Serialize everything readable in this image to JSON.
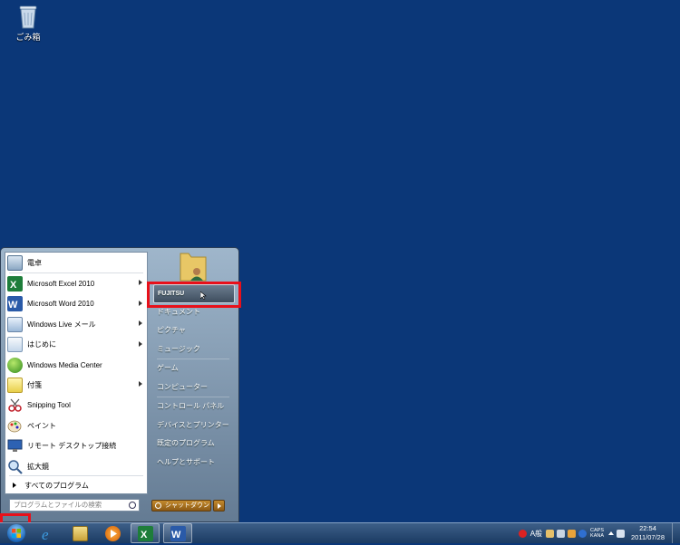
{
  "desktop": {
    "recycle_bin_label": "ごみ箱",
    "background_color": "#0b3778"
  },
  "start_menu": {
    "programs": [
      {
        "label": "電卓",
        "icon": "calculator-icon",
        "submenu": false
      },
      {
        "label": "Microsoft Excel 2010",
        "icon": "excel-icon",
        "submenu": true
      },
      {
        "label": "Microsoft Word 2010",
        "icon": "word-icon",
        "submenu": true
      },
      {
        "label": "Windows Live メール",
        "icon": "mail-icon",
        "submenu": true
      },
      {
        "label": "はじめに",
        "icon": "getting-started-icon",
        "submenu": true
      },
      {
        "label": "Windows Media Center",
        "icon": "media-center-icon",
        "submenu": false
      },
      {
        "label": "付箋",
        "icon": "sticky-notes-icon",
        "submenu": true
      },
      {
        "label": "Snipping Tool",
        "icon": "snipping-tool-icon",
        "submenu": false
      },
      {
        "label": "ペイント",
        "icon": "paint-icon",
        "submenu": false
      },
      {
        "label": "リモート デスクトップ接続",
        "icon": "remote-desktop-icon",
        "submenu": false
      },
      {
        "label": "拡大鏡",
        "icon": "magnifier-icon",
        "submenu": false
      }
    ],
    "all_programs_label": "すべてのプログラム",
    "search_placeholder": "プログラムとファイルの検索",
    "right_items": [
      {
        "label": "FUJITSU",
        "highlighted": true
      },
      {
        "label": "ドキュメント"
      },
      {
        "label": "ピクチャ"
      },
      {
        "label": "ミュージック"
      },
      {
        "label": "ゲーム"
      },
      {
        "label": "コンピューター"
      },
      {
        "label": "コントロール パネル"
      },
      {
        "label": "デバイスとプリンター"
      },
      {
        "label": "既定のプログラム"
      },
      {
        "label": "ヘルプとサポート"
      }
    ],
    "shutdown_label": "シャットダウン"
  },
  "taskbar": {
    "items": [
      {
        "icon": "internet-explorer-icon",
        "open": false
      },
      {
        "icon": "file-explorer-icon",
        "open": false
      },
      {
        "icon": "media-player-icon",
        "open": false
      },
      {
        "icon": "excel-icon",
        "open": true
      },
      {
        "icon": "word-icon",
        "open": true
      }
    ],
    "tray": {
      "ime_mode": "A般",
      "caps": "CAPS",
      "kana": "KANA",
      "time": "22:54",
      "date": "2011/07/28"
    }
  },
  "highlight_color": "#e8101a"
}
